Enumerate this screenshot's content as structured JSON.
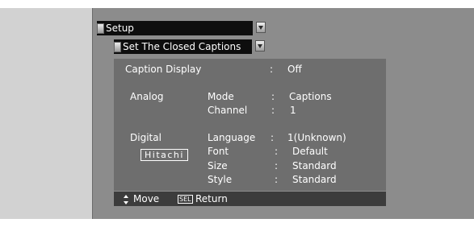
{
  "menu": {
    "title": "Setup",
    "submenu_title": "Set  The Closed Captions"
  },
  "caption_display": {
    "label": "Caption Display",
    "separator": ":",
    "value": "Off"
  },
  "analog": {
    "section_label": "Analog",
    "mode": {
      "label": "Mode",
      "separator": ":",
      "value": "Captions"
    },
    "channel": {
      "label": "Channel",
      "separator": ":",
      "value": "1"
    }
  },
  "digital": {
    "section_label": "Digital",
    "language": {
      "label": "Language",
      "separator": ":",
      "value": "1(Unknown)"
    },
    "font": {
      "label": "Font",
      "separator": ":",
      "value": "Default"
    },
    "size": {
      "label": "Size",
      "separator": ":",
      "value": "Standard"
    },
    "style": {
      "label": "Style",
      "separator": ":",
      "value": "Standard"
    }
  },
  "brand": "Hitachi",
  "footer": {
    "move_icon": "up-down-arrows-icon",
    "move_label": "Move",
    "sel_icon_text": "SEL",
    "return_label": "Return"
  }
}
